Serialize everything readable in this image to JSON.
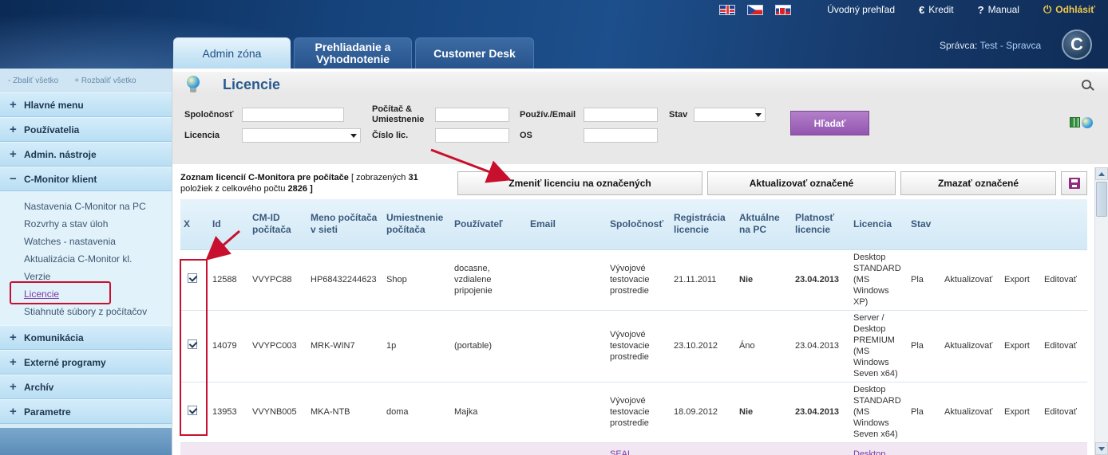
{
  "header": {
    "languages": [
      "English",
      "Čeština",
      "Slovenčina"
    ],
    "links": {
      "overview": "Úvodný prehľad",
      "credit": "Kredit",
      "credit_icon": "€",
      "manual": "Manual",
      "manual_icon": "?",
      "logout": "Odhlásiť",
      "logout_icon": "⏻"
    },
    "tabs": [
      {
        "label": "Admin zóna"
      },
      {
        "label": "Prehliadanie a Vyhodnotenie"
      },
      {
        "label": "Customer Desk"
      }
    ],
    "user_prefix": "Správca:",
    "user_name": "Test - Spravca",
    "logo": "C"
  },
  "sidebar": {
    "collapse_all": "- Zbaliť všetko",
    "expand_all": "+ Rozbaliť všetko",
    "items": [
      {
        "label": "Hlavné menu",
        "sign": "+"
      },
      {
        "label": "Používatelia",
        "sign": "+"
      },
      {
        "label": "Admin. nástroje",
        "sign": "+"
      },
      {
        "label": "C-Monitor klient",
        "sign": "−"
      }
    ],
    "submenu": [
      "Nastavenia C-Monitor na PC",
      "Rozvrhy a stav úloh",
      "Watches - nastavenia",
      "Aktualizácia C-Monitor kl.",
      "Verzie",
      "Licencie",
      "Stiahnuté súbory z počítačov"
    ],
    "items_after": [
      {
        "label": "Komunikácia",
        "sign": "+"
      },
      {
        "label": "Externé programy",
        "sign": "+"
      },
      {
        "label": "Archív",
        "sign": "+"
      },
      {
        "label": "Parametre",
        "sign": "+"
      }
    ]
  },
  "page": {
    "title": "Licencie"
  },
  "filters": {
    "company_label": "Spoločnosť",
    "license_label": "Licencia",
    "computer_label": "Počítač & Umiestnenie",
    "license_no_label": "Číslo lic.",
    "user_label": "Použív./Email",
    "os_label": "OS",
    "state_label": "Stav",
    "search_button": "Hľadať"
  },
  "list": {
    "info_prefix": "Zoznam licencií C-Monitora pre počítače",
    "info_shown_pre": "[ zobrazených",
    "shown": "31",
    "info_mid": "položiek z celkového počtu",
    "total": "2826",
    "info_end": "]",
    "btn_change": "Zmeniť licenciu na označených",
    "btn_update": "Aktualizovať označené",
    "btn_delete": "Zmazať označené"
  },
  "table": {
    "columns": [
      "X",
      "Id",
      "CM-ID počítača",
      "Meno počítača v sieti",
      "Umiestnenie počítača",
      "Používateľ",
      "Email",
      "Spoločnosť",
      "Registrácia licencie",
      "Aktuálne na PC",
      "Platnosť licencie",
      "Licencia",
      "Stav",
      "",
      "",
      ""
    ],
    "rows": [
      {
        "checked": true,
        "id": "12588",
        "cmid": "VVYPC88",
        "name": "HP68432244623",
        "location": "Shop",
        "user": "docasne, vzdialene pripojenie",
        "email": "",
        "company": "Vývojové testovacie prostredie",
        "registration": "21.11.2011",
        "current": "Nie",
        "validity": "23.04.2013",
        "license": "Desktop STANDARD (MS Windows XP)",
        "state": "Pla",
        "action_update": "Aktualizovať",
        "action_export": "Export",
        "action_edit": "Editovať"
      },
      {
        "checked": true,
        "id": "14079",
        "cmid": "VVYPC003",
        "name": "MRK-WIN7",
        "location": "1p",
        "user": "(portable)",
        "email": "",
        "company": "Vývojové testovacie prostredie",
        "registration": "23.10.2012",
        "current": "Áno",
        "validity": "23.04.2013",
        "license": "Server / Desktop PREMIUM (MS Windows Seven x64)",
        "state": "Pla",
        "action_update": "Aktualizovať",
        "action_export": "Export",
        "action_edit": "Editovať"
      },
      {
        "checked": true,
        "id": "13953",
        "cmid": "VVYNB005",
        "name": "MKA-NTB",
        "location": "doma",
        "user": "Majka",
        "email": "",
        "company": "Vývojové testovacie prostredie",
        "registration": "18.09.2012",
        "current": "Nie",
        "validity": "23.04.2013",
        "license": "Desktop STANDARD (MS Windows Seven x64)",
        "state": "Pla",
        "action_update": "Aktualizovať",
        "action_export": "Export",
        "action_edit": "Editovať"
      },
      {
        "partial_company": "SEAL",
        "partial_license": "Desktop"
      }
    ]
  },
  "colors": {
    "accent": "#2a5b8f",
    "search_button": "#9356b0",
    "annotation": "#c8102e"
  }
}
